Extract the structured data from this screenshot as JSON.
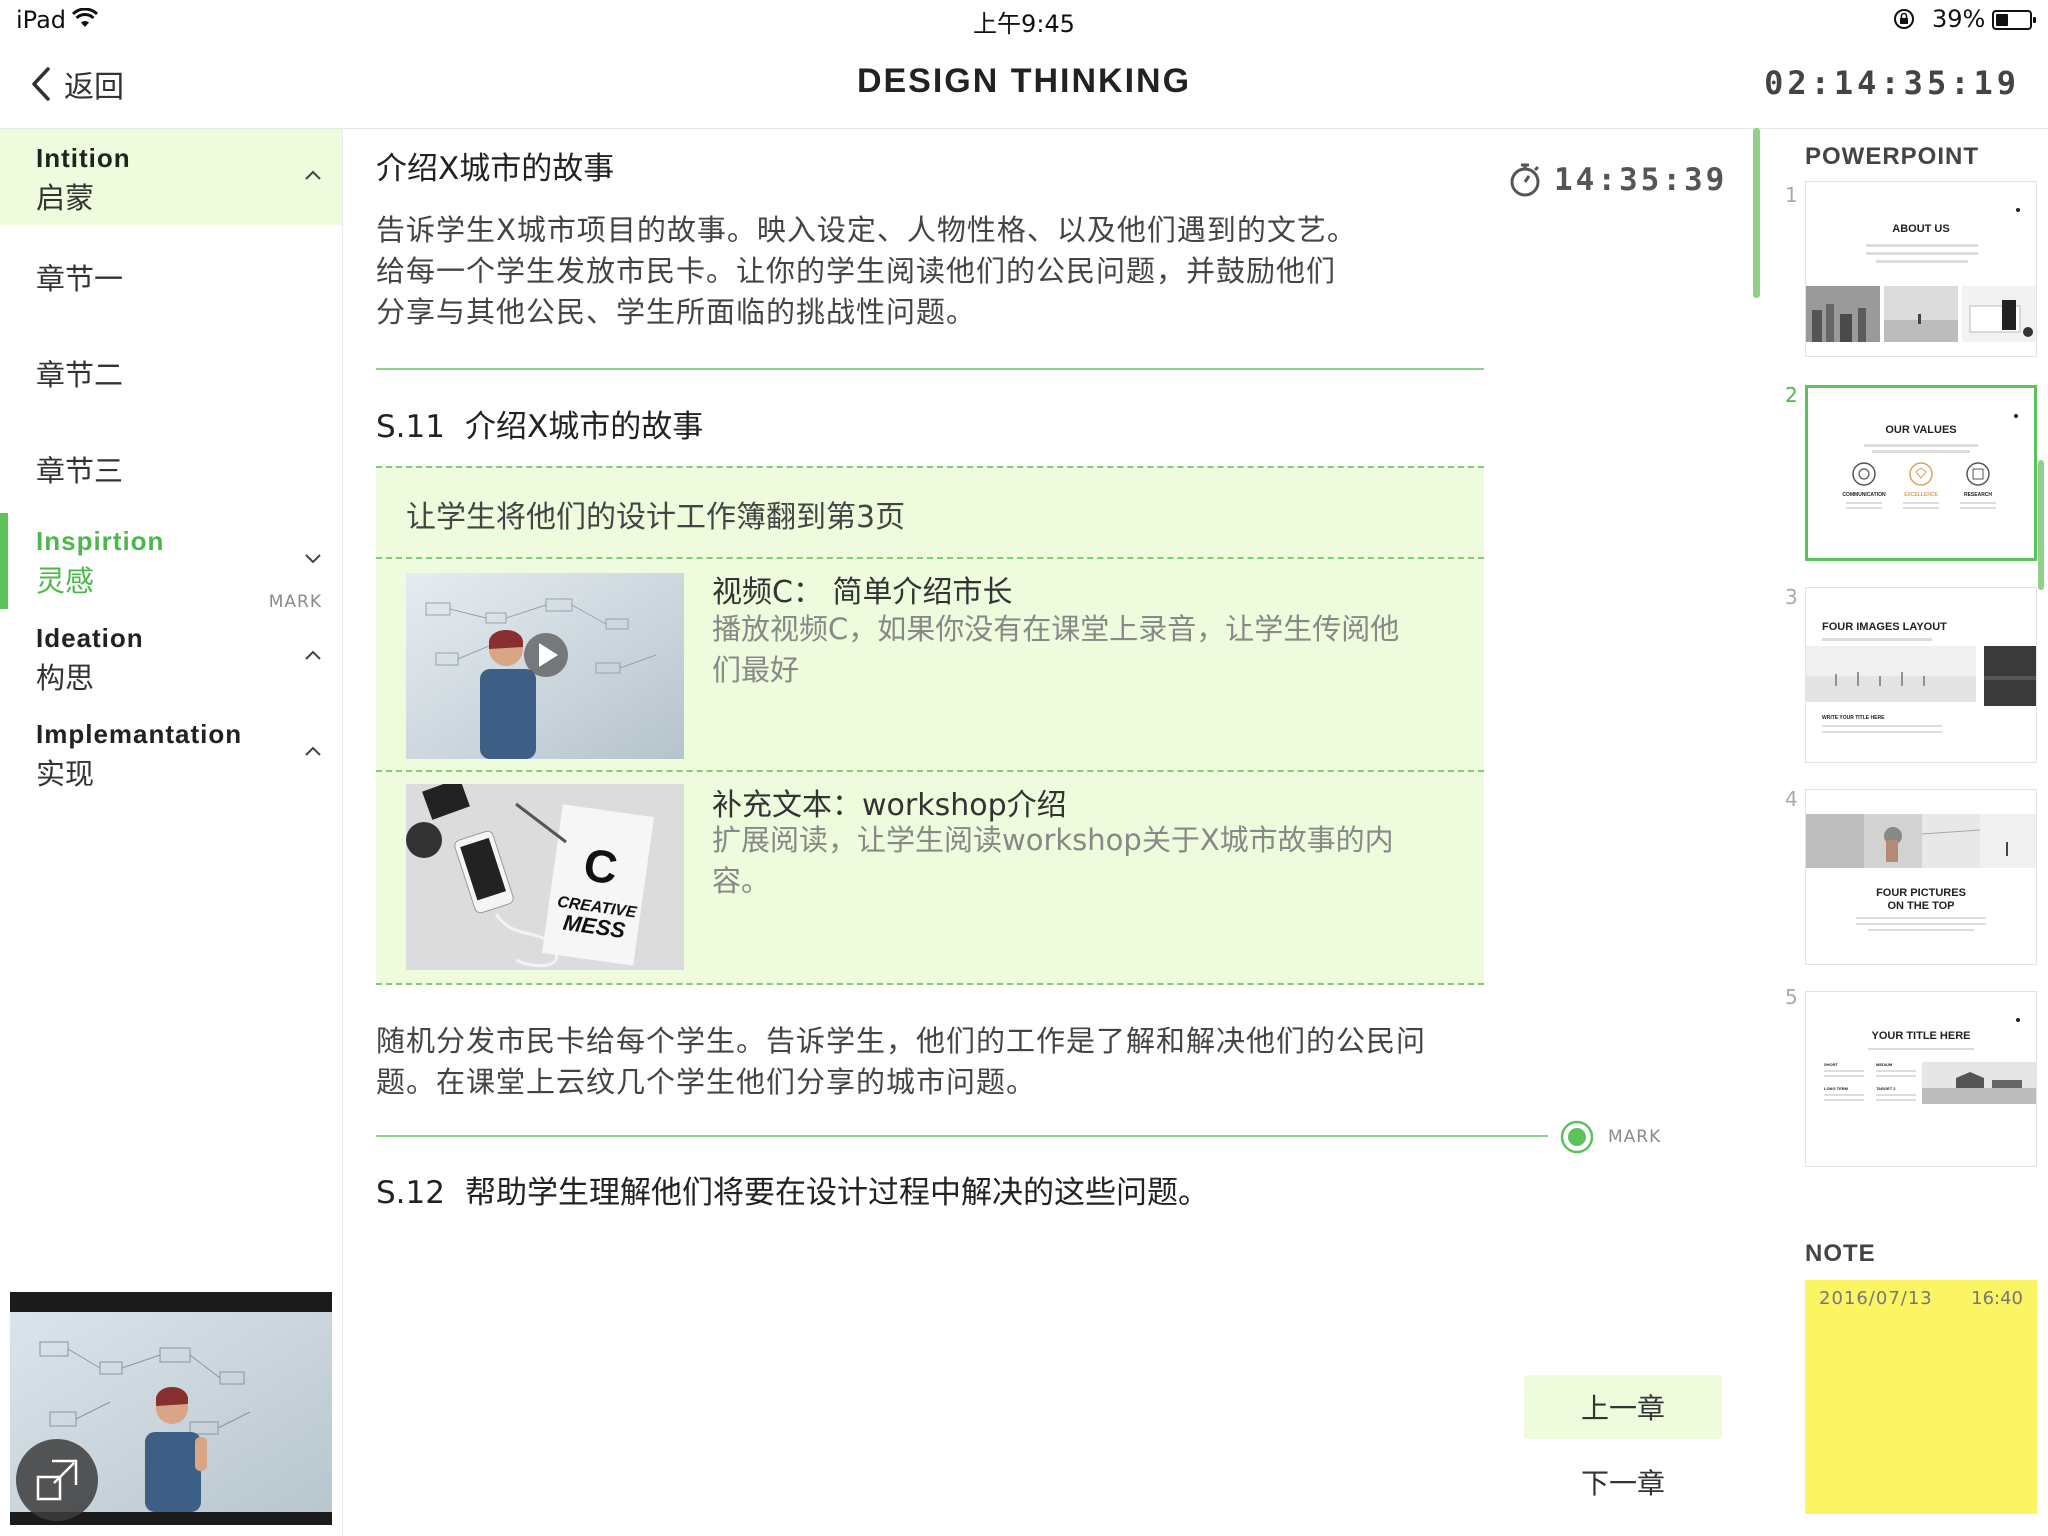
{
  "status": {
    "device": "iPad",
    "time": "上午9:45",
    "battery": "39%",
    "battery_level": 0.39
  },
  "nav": {
    "back": "返回",
    "title": "DESIGN THINKING",
    "clock": "02:14:35:19"
  },
  "sidebar": {
    "sections": [
      {
        "en": "Intition",
        "zh": "启蒙",
        "state": "expanded"
      },
      {
        "en": "Inspirtion",
        "zh": "灵感",
        "state": "collapsed",
        "mark": "MARK"
      },
      {
        "en": "Ideation",
        "zh": "构思",
        "state": "expanded"
      },
      {
        "en": "Implemantation",
        "zh": "实现",
        "state": "expanded"
      }
    ],
    "chapters": [
      "章节一",
      "章节二",
      "章节三"
    ]
  },
  "main": {
    "title": "介绍X城市的故事",
    "timer": "14:35:39",
    "intro": [
      "告诉学生X城市项目的故事。映入设定、人物性格、以及他们遇到的文艺。",
      "给每一个学生发放市民卡。让你的学生阅读他们的公民问题，并鼓励他们",
      "分享与其他公民、学生所面临的挑战性问题。"
    ],
    "s11": {
      "num": "S.11",
      "title": "介绍X城市的故事"
    },
    "box_text": "让学生将他们的设计工作簿翻到第3页",
    "media": [
      {
        "title": "视频C：  简单介绍市长",
        "desc": [
          "播放视频C，如果你没有在课堂上录音，让学生传阅他",
          "们最好"
        ]
      },
      {
        "title": "补充文本：workshop介绍",
        "desc": [
          "扩展阅读，让学生阅读workshop关于X城市故事的内",
          "容。"
        ],
        "book_text": [
          "C",
          "CREATIVE",
          "MESS"
        ]
      }
    ],
    "para2": [
      "随机分发市民卡给每个学生。告诉学生，他们的工作是了解和解决他们的公民问",
      "题。在课堂上云纹几个学生他们分享的城市问题。"
    ],
    "mark": "MARK",
    "s12": {
      "num": "S.12",
      "title": "帮助学生理解他们将要在设计过程中解决的这些问题。"
    },
    "prev": "上一章",
    "next": "下一章"
  },
  "powerpoint": {
    "heading": "POWERPOINT",
    "selected": 2,
    "slides": [
      {
        "num": "1",
        "title": "ABOUT US"
      },
      {
        "num": "2",
        "title": "OUR VALUES",
        "labels": [
          "COMMUNICATION",
          "EXCELLENCE",
          "RESEARCH"
        ]
      },
      {
        "num": "3",
        "title": "FOUR IMAGES LAYOUT",
        "sub": "WRITE YOUR TITLE HERE"
      },
      {
        "num": "4",
        "title": "FOUR PICTURES",
        "title2": "ON THE TOP"
      },
      {
        "num": "5",
        "title": "YOUR TITLE HERE",
        "labels": [
          "SHORT",
          "MEDIUM",
          "LONG TERM",
          "TARGET 2"
        ]
      }
    ]
  },
  "note": {
    "heading": "NOTE",
    "date": "2016/07/13",
    "time": "16:40",
    "color": "#fbf463"
  },
  "colors": {
    "accent": "#5cc35a",
    "highlight": "#eefbdc"
  }
}
